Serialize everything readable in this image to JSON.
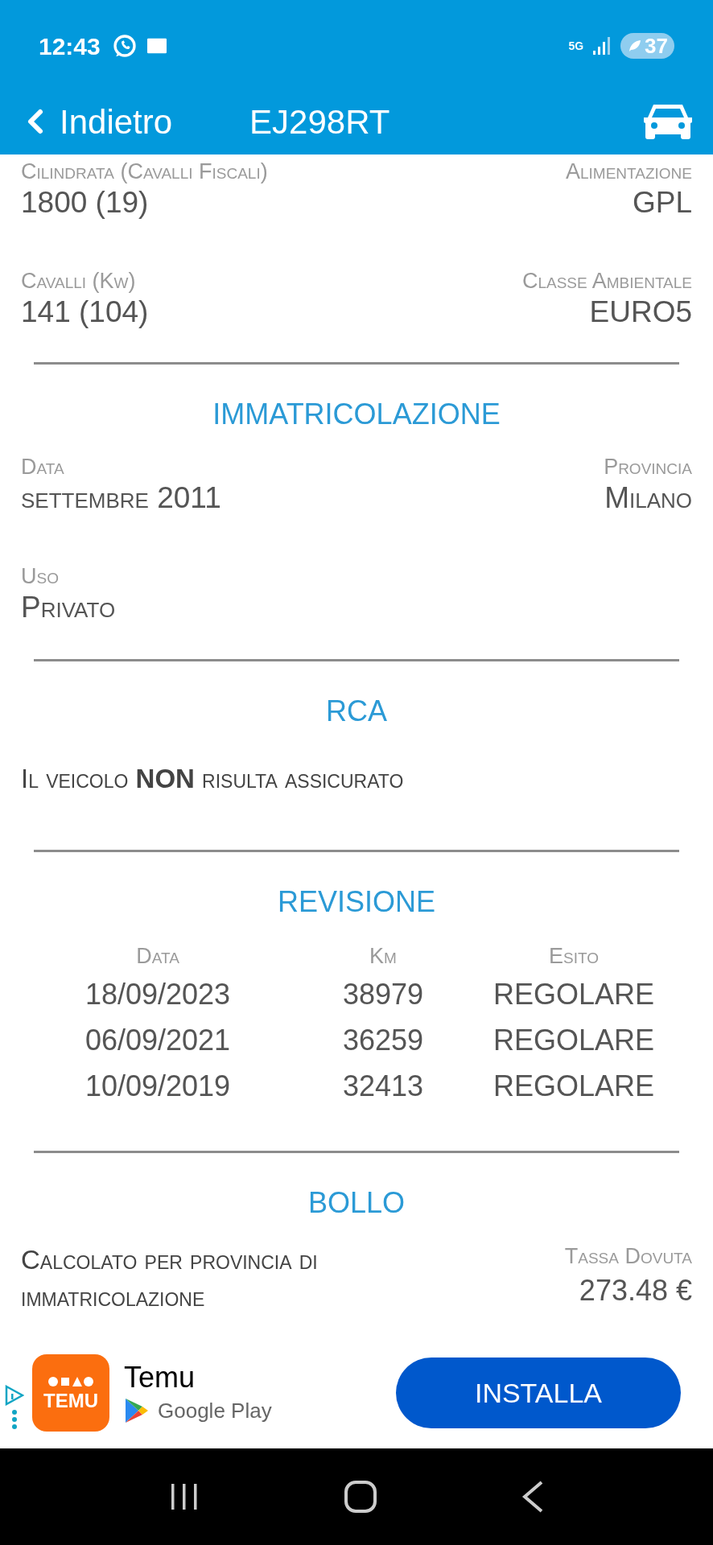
{
  "status_bar": {
    "time": "12:43",
    "network": "5G",
    "battery": "37"
  },
  "header": {
    "back": "Indietro",
    "title": "EJ298RT"
  },
  "top_fields": [
    {
      "left": {
        "label": "Cilindrata (Cavalli Fiscali)",
        "value": "1800 (19)"
      },
      "right": {
        "label": "Alimentazione",
        "value": "GPL"
      }
    },
    {
      "left": {
        "label": "Cavalli (Kw)",
        "value": "141 (104)"
      },
      "right": {
        "label": "Classe Ambientale",
        "value": "EURO5"
      }
    }
  ],
  "sections": [
    {
      "kind": "fields",
      "title": "IMMATRICOLAZIONE",
      "rows": [
        {
          "left": {
            "label": "Data",
            "value": "settembre 2011"
          },
          "right": {
            "label": "Provincia",
            "value": "Milano"
          }
        },
        {
          "left": {
            "label": "Uso",
            "value": "Privato"
          }
        }
      ]
    },
    {
      "kind": "text",
      "title": "RCA",
      "text": "Il veicolo **NON** risulta assicurato"
    },
    {
      "kind": "table",
      "title": "REVISIONE",
      "columns": [
        "Data",
        "Km",
        "Esito"
      ],
      "rows": [
        [
          "18/09/2023",
          "38979",
          "REGOLARE"
        ],
        [
          "06/09/2021",
          "36259",
          "REGOLARE"
        ],
        [
          "10/09/2019",
          "32413",
          "REGOLARE"
        ]
      ]
    },
    {
      "kind": "tax",
      "title": "BOLLO",
      "text": "Calcolato per provincia di immatricolazione",
      "label": "Tassa Dovuta",
      "value": "273.48 €"
    }
  ],
  "ad": {
    "icon_text": "TEMU",
    "app": "Temu",
    "store": "Google Play",
    "button": "INSTALLA"
  }
}
